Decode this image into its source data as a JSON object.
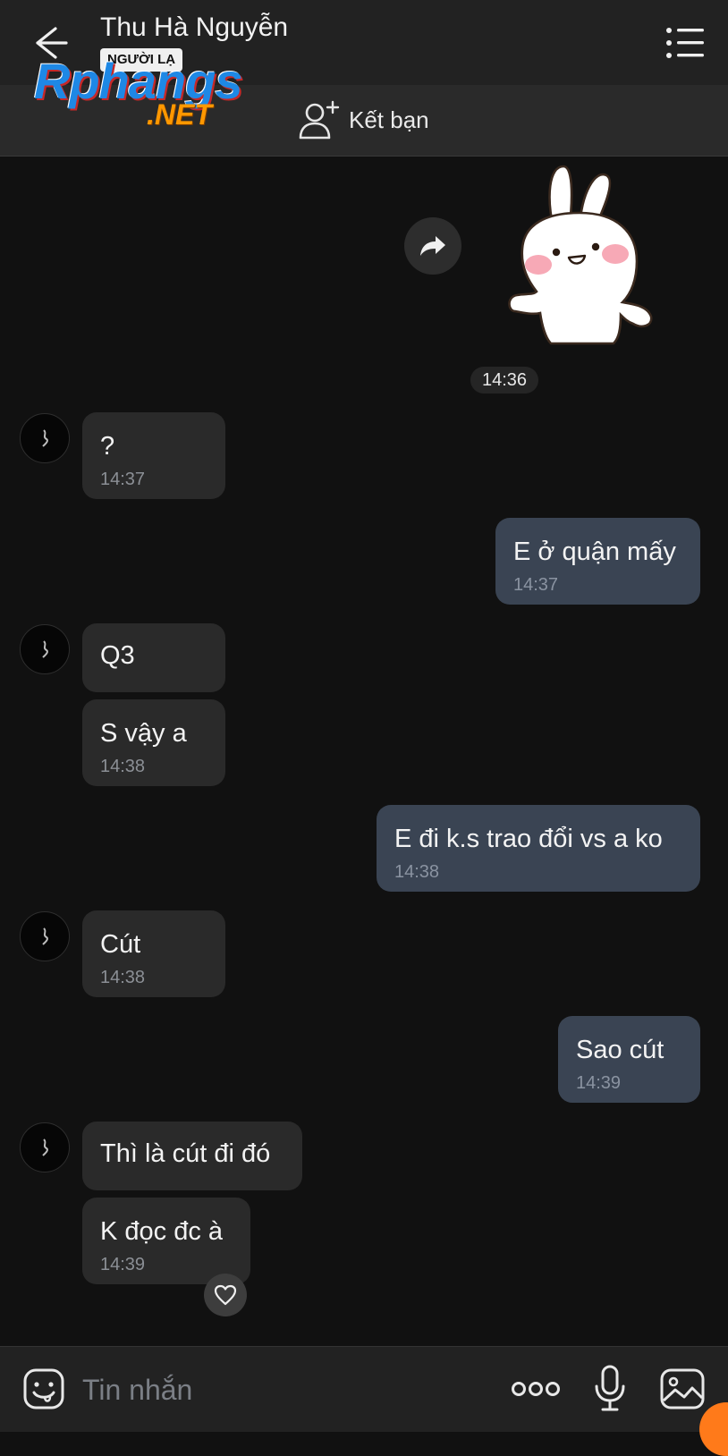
{
  "header": {
    "title": "Thu Hà Nguyễn",
    "stranger_badge": "NGƯỜI LẠ",
    "add_friend_label": "Kết bạn"
  },
  "watermark": {
    "main": "Rphangs",
    "sub": ".NET"
  },
  "sticker": {
    "time": "14:36"
  },
  "messages": [
    {
      "side": "in",
      "text": "?",
      "time": "14:37"
    },
    {
      "side": "out",
      "text": "E ở quận mấy",
      "time": "14:37"
    },
    {
      "side": "in",
      "text": "Q3",
      "time": ""
    },
    {
      "side": "in",
      "text": "S vậy a",
      "time": "14:38"
    },
    {
      "side": "out",
      "text": "E đi k.s trao đổi vs a ko",
      "time": "14:38"
    },
    {
      "side": "in",
      "text": "Cút",
      "time": "14:38"
    },
    {
      "side": "out",
      "text": "Sao cút",
      "time": "14:39"
    },
    {
      "side": "in",
      "text": "Thì là cút đi đó",
      "time": ""
    },
    {
      "side": "in",
      "text": "K đọc đc à",
      "time": "14:39"
    }
  ],
  "composer": {
    "placeholder": "Tin nhắn"
  },
  "colors": {
    "background": "#111111",
    "incoming_bubble": "#2a2a2a",
    "outgoing_bubble": "#3a4453",
    "accent_orange": "#ff7a1a"
  },
  "icons": [
    "back-arrow-icon",
    "list-menu-icon",
    "add-user-icon",
    "share-forward-icon",
    "heart-icon",
    "emoji-icon",
    "more-dots-icon",
    "microphone-icon",
    "image-icon"
  ]
}
